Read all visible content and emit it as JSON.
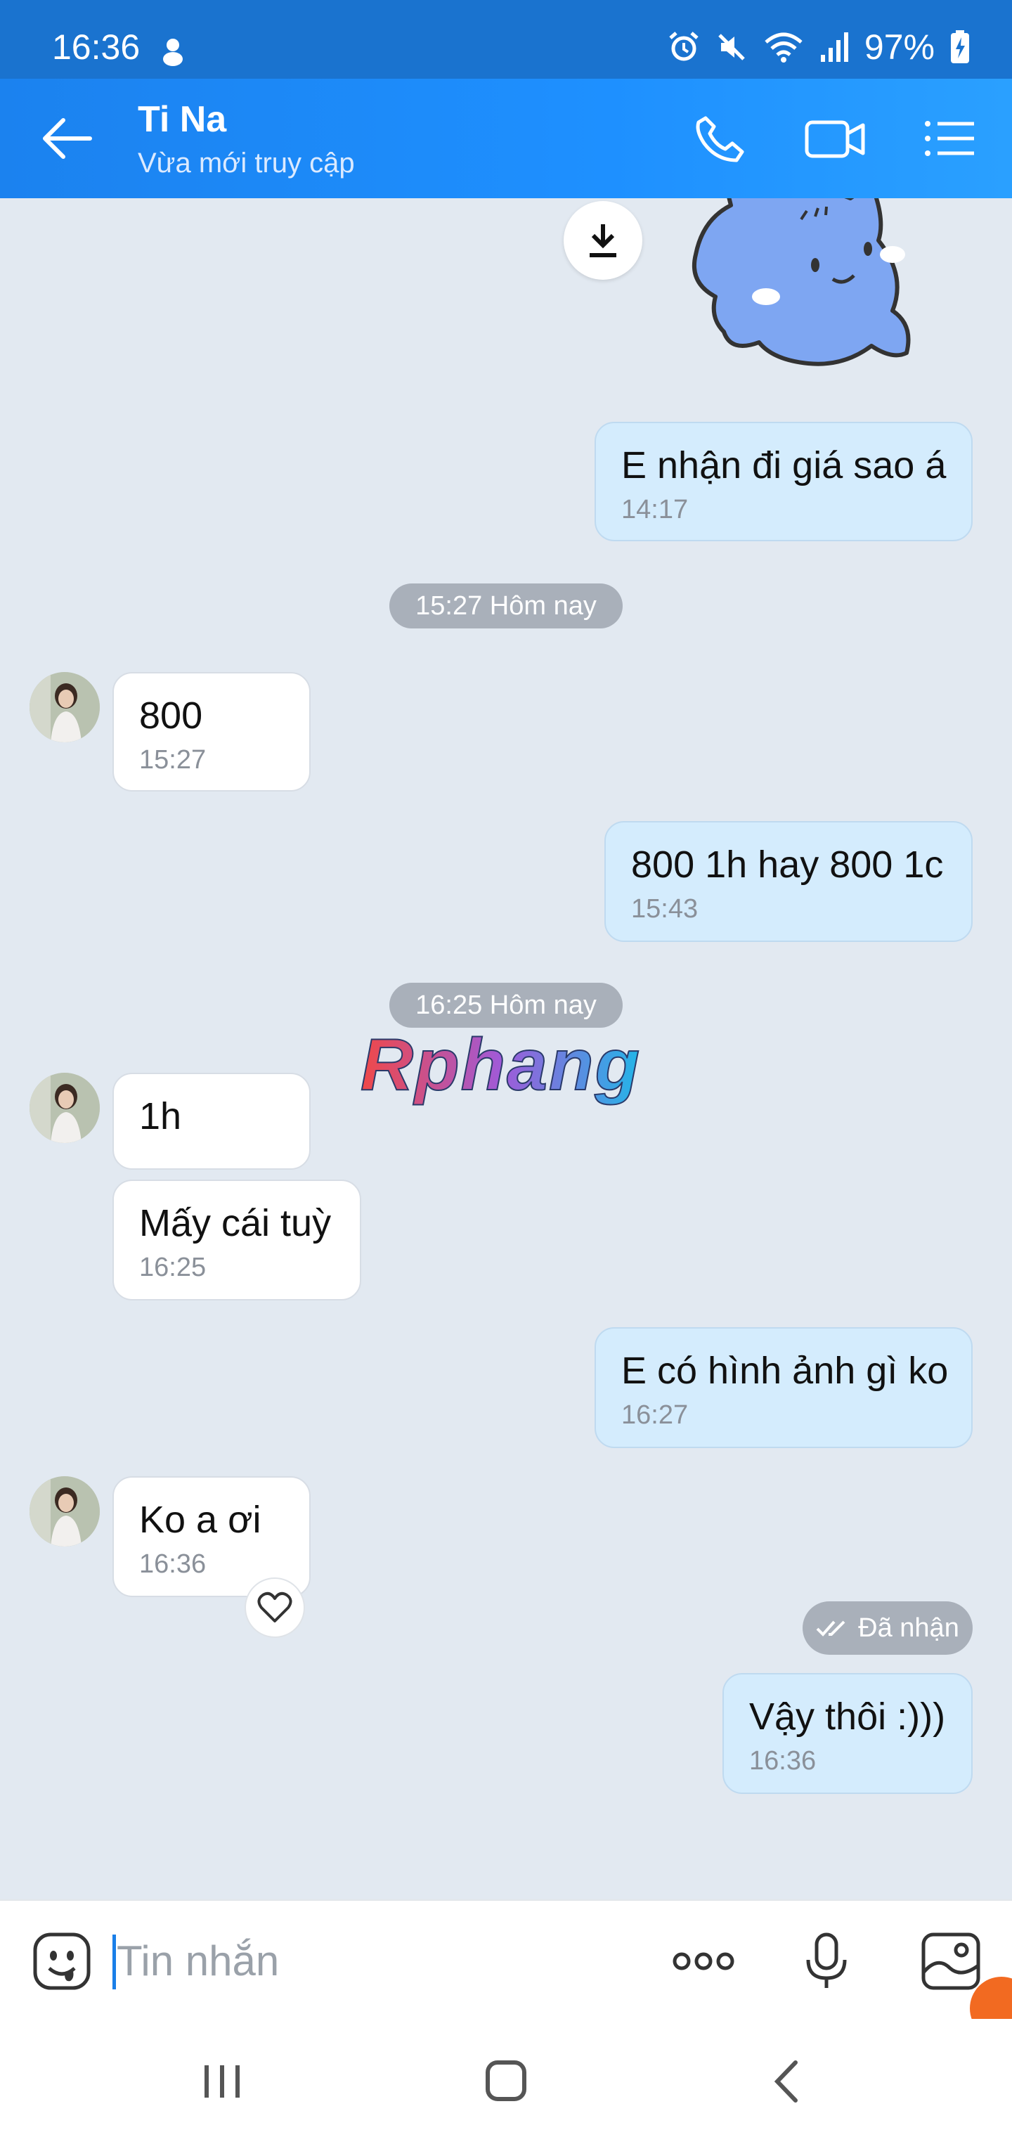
{
  "status_bar": {
    "time": "16:36",
    "battery": "97%"
  },
  "header": {
    "contact_name": "Ti Na",
    "contact_status": "Vừa mới truy cập",
    "accent_color": "#1e88f5"
  },
  "messages": [
    {
      "from": "me",
      "text": "E nhận đi giá sao á",
      "time": "14:17"
    },
    {
      "from": "them",
      "text": "800",
      "time": "15:27"
    },
    {
      "from": "me",
      "text": "800 1h hay 800 1c",
      "time": "15:43"
    },
    {
      "from": "them",
      "text": "1h",
      "time": ""
    },
    {
      "from": "them",
      "text": "Mấy cái tuỳ",
      "time": "16:25"
    },
    {
      "from": "me",
      "text": "E có hình ảnh gì ko",
      "time": "16:27"
    },
    {
      "from": "them",
      "text": "Ko a ơi",
      "time": "16:36"
    },
    {
      "from": "me",
      "text": "Vậy thôi :)))",
      "time": "16:36"
    }
  ],
  "date_separators": [
    "15:27 Hôm nay",
    "16:25 Hôm nay"
  ],
  "delivery_status": "Đã nhận",
  "watermark": "Rphang",
  "input": {
    "placeholder": "Tin nhắn",
    "value": ""
  },
  "icons": {
    "back": "arrow-left-icon",
    "call": "phone-icon",
    "video": "video-camera-icon",
    "menu": "list-menu-icon",
    "download": "download-icon",
    "reaction": "heart-icon",
    "emoji": "emoji-icon",
    "more": "more-dots-icon",
    "mic": "microphone-icon",
    "gallery": "image-icon"
  }
}
